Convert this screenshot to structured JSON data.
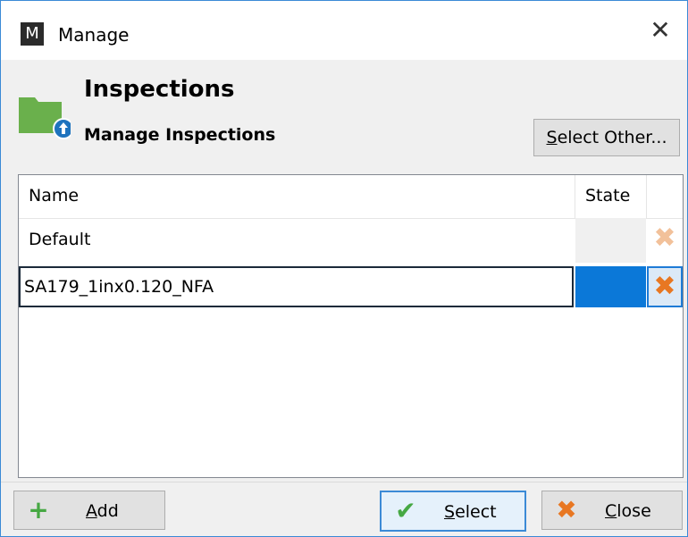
{
  "window": {
    "app_icon_letter": "M",
    "title": "Manage",
    "close_glyph": "✕"
  },
  "header": {
    "title": "Inspections",
    "subtitle": "Manage Inspections",
    "icon": "folder-upload-icon",
    "select_other_label_hotkey": "S",
    "select_other_label_rest": "elect Other..."
  },
  "list": {
    "columns": [
      "Name",
      "State"
    ],
    "rows": [
      {
        "name": "Default",
        "state": "",
        "delete_icon": "delete-x-icon"
      }
    ],
    "editing_row": {
      "value": "SA179_1inx0.120_NFA",
      "delete_icon": "delete-x-icon"
    }
  },
  "footer": {
    "add": {
      "hotkey": "A",
      "rest": "dd",
      "icon": "plus-icon"
    },
    "select": {
      "hotkey": "S",
      "rest": "elect",
      "icon": "checkmark-icon"
    },
    "close": {
      "hotkey": "C",
      "rest": "lose",
      "icon": "x-icon"
    }
  },
  "colors": {
    "accent": "#0b78d8",
    "folder_green": "#6ab04c",
    "delete_orange": "#e87722",
    "check_green": "#46a843"
  }
}
